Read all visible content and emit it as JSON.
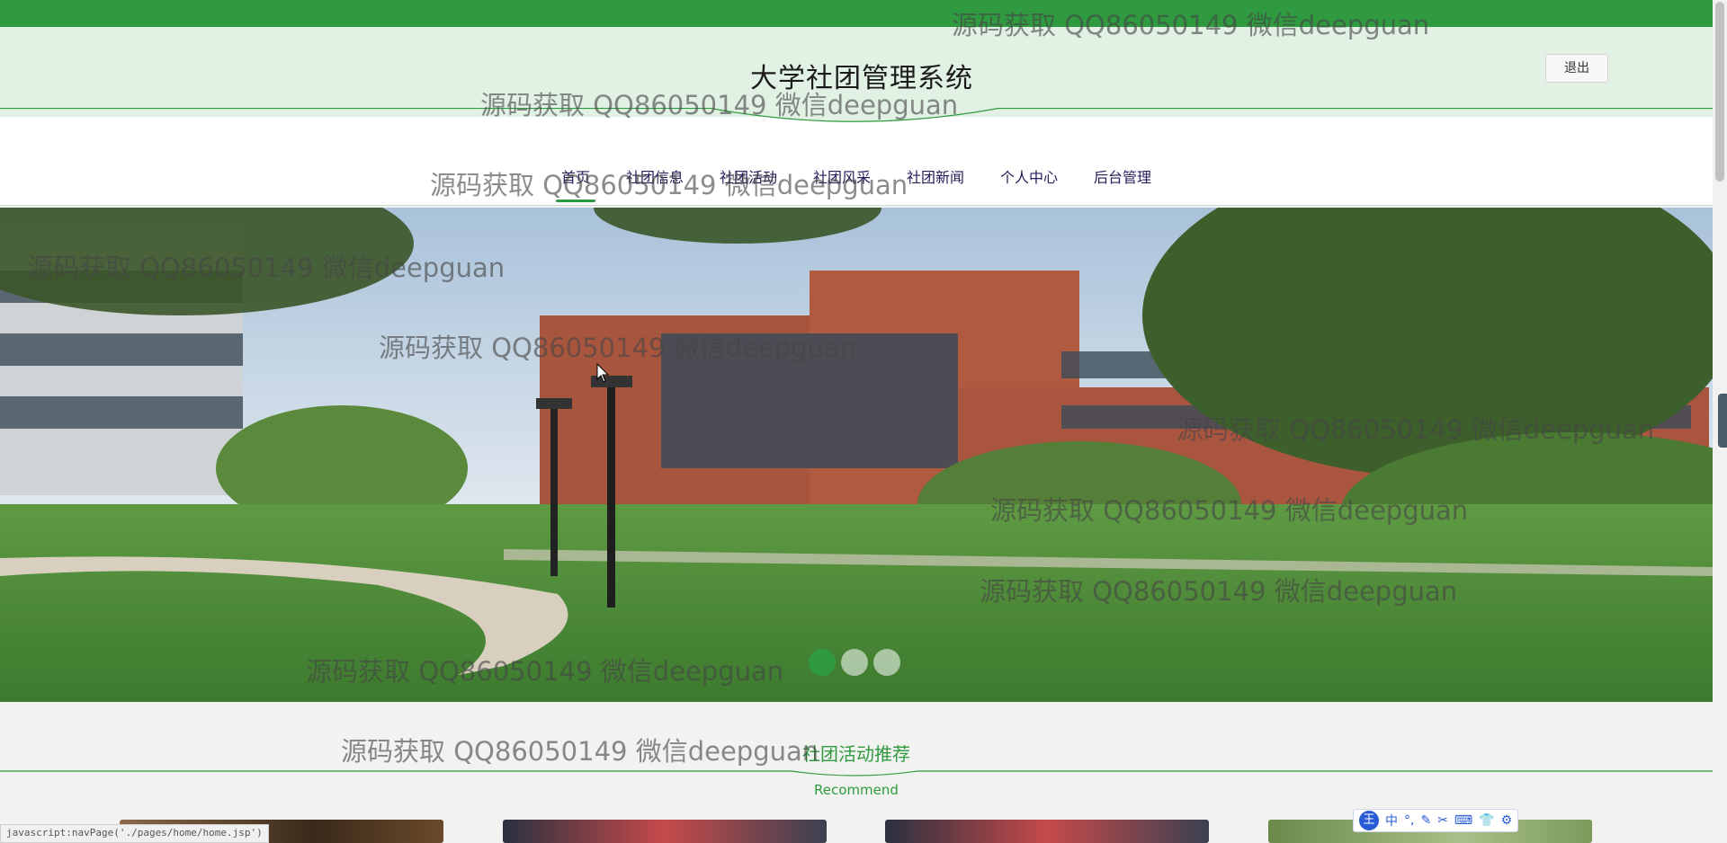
{
  "site": {
    "title": "大学社团管理系统",
    "logout_label": "退出"
  },
  "nav": {
    "items": [
      {
        "label": "首页",
        "active": true
      },
      {
        "label": "社团信息",
        "active": false
      },
      {
        "label": "社团活动",
        "active": false
      },
      {
        "label": "社团风采",
        "active": false
      },
      {
        "label": "社团新闻",
        "active": false
      },
      {
        "label": "个人中心",
        "active": false
      },
      {
        "label": "后台管理",
        "active": false
      }
    ]
  },
  "banner": {
    "slide_count": 3,
    "active_slide": 1
  },
  "recommend": {
    "title": "社团活动推荐",
    "subtitle": "Recommend"
  },
  "watermark": {
    "text": "源码获取 QQ86050149 微信deepguan"
  },
  "status_bar": {
    "url": "javascript:navPage('./pages/home/home.jsp')"
  },
  "ime_toolbar": {
    "logo": "王",
    "mode": "中",
    "icons": [
      "punctuation-icon",
      "pen-icon",
      "scissors-icon",
      "keyboard-icon",
      "shirt-icon",
      "gear-icon"
    ]
  },
  "colors": {
    "brand_green": "#2f9a3f",
    "header_bg": "#e1f1e3",
    "nav_text": "#2a1a5a"
  }
}
